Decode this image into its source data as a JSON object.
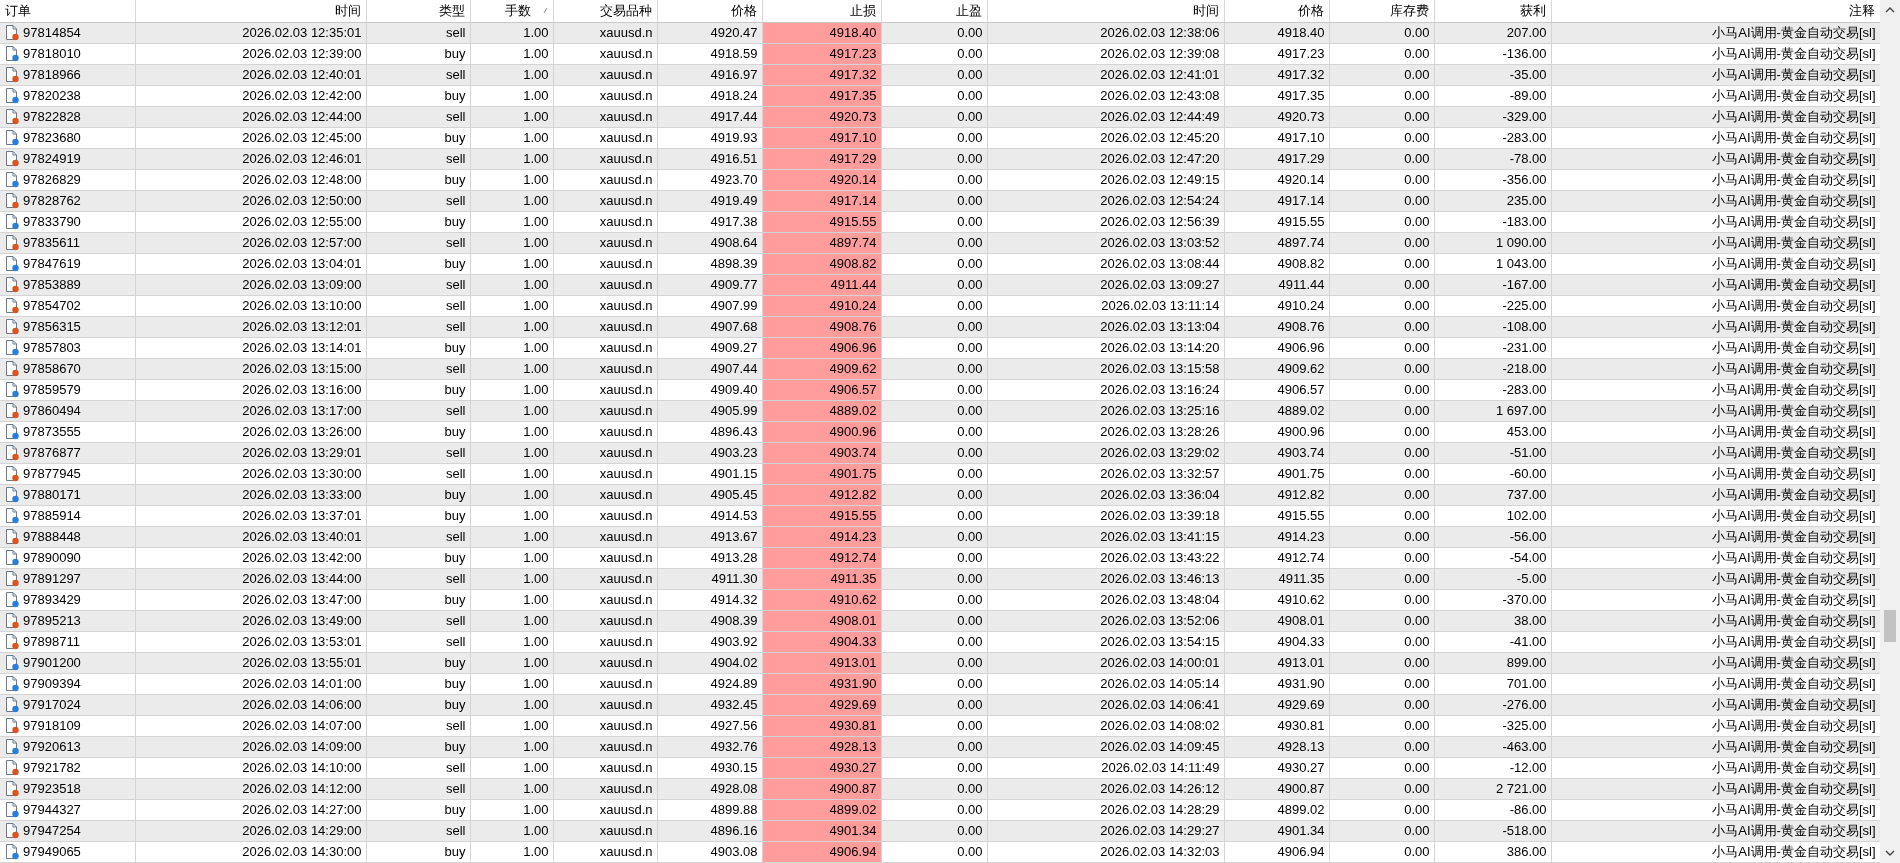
{
  "table": {
    "columns": [
      {
        "label": "订单",
        "sorted": false
      },
      {
        "label": "时间",
        "sorted": false
      },
      {
        "label": "类型",
        "sorted": false
      },
      {
        "label": "手数",
        "sorted": true
      },
      {
        "label": "交易品种",
        "sorted": false
      },
      {
        "label": "价格",
        "sorted": false
      },
      {
        "label": "止损",
        "sorted": false
      },
      {
        "label": "止盈",
        "sorted": false
      },
      {
        "label": "时间",
        "sorted": false
      },
      {
        "label": "价格",
        "sorted": false
      },
      {
        "label": "库存费",
        "sorted": false
      },
      {
        "label": "获利",
        "sorted": false
      },
      {
        "label": "注释",
        "sorted": false
      }
    ],
    "rows": [
      {
        "kind": "sell",
        "cells": [
          "97814854",
          "2026.02.03 12:35:01",
          "sell",
          "1.00",
          "xauusd.n",
          "4920.47",
          "4918.40",
          "0.00",
          "2026.02.03 12:38:06",
          "4918.40",
          "0.00",
          "207.00",
          "小马AI调用-黄金自动交易[sl]"
        ]
      },
      {
        "kind": "buy",
        "cells": [
          "97818010",
          "2026.02.03 12:39:00",
          "buy",
          "1.00",
          "xauusd.n",
          "4918.59",
          "4917.23",
          "0.00",
          "2026.02.03 12:39:08",
          "4917.23",
          "0.00",
          "-136.00",
          "小马AI调用-黄金自动交易[sl]"
        ]
      },
      {
        "kind": "sell",
        "cells": [
          "97818966",
          "2026.02.03 12:40:01",
          "sell",
          "1.00",
          "xauusd.n",
          "4916.97",
          "4917.32",
          "0.00",
          "2026.02.03 12:41:01",
          "4917.32",
          "0.00",
          "-35.00",
          "小马AI调用-黄金自动交易[sl]"
        ]
      },
      {
        "kind": "buy",
        "cells": [
          "97820238",
          "2026.02.03 12:42:00",
          "buy",
          "1.00",
          "xauusd.n",
          "4918.24",
          "4917.35",
          "0.00",
          "2026.02.03 12:43:08",
          "4917.35",
          "0.00",
          "-89.00",
          "小马AI调用-黄金自动交易[sl]"
        ]
      },
      {
        "kind": "sell",
        "cells": [
          "97822828",
          "2026.02.03 12:44:00",
          "sell",
          "1.00",
          "xauusd.n",
          "4917.44",
          "4920.73",
          "0.00",
          "2026.02.03 12:44:49",
          "4920.73",
          "0.00",
          "-329.00",
          "小马AI调用-黄金自动交易[sl]"
        ]
      },
      {
        "kind": "buy",
        "cells": [
          "97823680",
          "2026.02.03 12:45:00",
          "buy",
          "1.00",
          "xauusd.n",
          "4919.93",
          "4917.10",
          "0.00",
          "2026.02.03 12:45:20",
          "4917.10",
          "0.00",
          "-283.00",
          "小马AI调用-黄金自动交易[sl]"
        ]
      },
      {
        "kind": "sell",
        "cells": [
          "97824919",
          "2026.02.03 12:46:01",
          "sell",
          "1.00",
          "xauusd.n",
          "4916.51",
          "4917.29",
          "0.00",
          "2026.02.03 12:47:20",
          "4917.29",
          "0.00",
          "-78.00",
          "小马AI调用-黄金自动交易[sl]"
        ]
      },
      {
        "kind": "buy",
        "cells": [
          "97826829",
          "2026.02.03 12:48:00",
          "buy",
          "1.00",
          "xauusd.n",
          "4923.70",
          "4920.14",
          "0.00",
          "2026.02.03 12:49:15",
          "4920.14",
          "0.00",
          "-356.00",
          "小马AI调用-黄金自动交易[sl]"
        ]
      },
      {
        "kind": "sell",
        "cells": [
          "97828762",
          "2026.02.03 12:50:00",
          "sell",
          "1.00",
          "xauusd.n",
          "4919.49",
          "4917.14",
          "0.00",
          "2026.02.03 12:54:24",
          "4917.14",
          "0.00",
          "235.00",
          "小马AI调用-黄金自动交易[sl]"
        ]
      },
      {
        "kind": "buy",
        "cells": [
          "97833790",
          "2026.02.03 12:55:00",
          "buy",
          "1.00",
          "xauusd.n",
          "4917.38",
          "4915.55",
          "0.00",
          "2026.02.03 12:56:39",
          "4915.55",
          "0.00",
          "-183.00",
          "小马AI调用-黄金自动交易[sl]"
        ]
      },
      {
        "kind": "sell",
        "cells": [
          "97835611",
          "2026.02.03 12:57:00",
          "sell",
          "1.00",
          "xauusd.n",
          "4908.64",
          "4897.74",
          "0.00",
          "2026.02.03 13:03:52",
          "4897.74",
          "0.00",
          "1 090.00",
          "小马AI调用-黄金自动交易[sl]"
        ]
      },
      {
        "kind": "buy",
        "cells": [
          "97847619",
          "2026.02.03 13:04:01",
          "buy",
          "1.00",
          "xauusd.n",
          "4898.39",
          "4908.82",
          "0.00",
          "2026.02.03 13:08:44",
          "4908.82",
          "0.00",
          "1 043.00",
          "小马AI调用-黄金自动交易[sl]"
        ]
      },
      {
        "kind": "sell",
        "cells": [
          "97853889",
          "2026.02.03 13:09:00",
          "sell",
          "1.00",
          "xauusd.n",
          "4909.77",
          "4911.44",
          "0.00",
          "2026.02.03 13:09:27",
          "4911.44",
          "0.00",
          "-167.00",
          "小马AI调用-黄金自动交易[sl]"
        ]
      },
      {
        "kind": "sell",
        "cells": [
          "97854702",
          "2026.02.03 13:10:00",
          "sell",
          "1.00",
          "xauusd.n",
          "4907.99",
          "4910.24",
          "0.00",
          "2026.02.03 13:11:14",
          "4910.24",
          "0.00",
          "-225.00",
          "小马AI调用-黄金自动交易[sl]"
        ]
      },
      {
        "kind": "sell",
        "cells": [
          "97856315",
          "2026.02.03 13:12:01",
          "sell",
          "1.00",
          "xauusd.n",
          "4907.68",
          "4908.76",
          "0.00",
          "2026.02.03 13:13:04",
          "4908.76",
          "0.00",
          "-108.00",
          "小马AI调用-黄金自动交易[sl]"
        ]
      },
      {
        "kind": "buy",
        "cells": [
          "97857803",
          "2026.02.03 13:14:01",
          "buy",
          "1.00",
          "xauusd.n",
          "4909.27",
          "4906.96",
          "0.00",
          "2026.02.03 13:14:20",
          "4906.96",
          "0.00",
          "-231.00",
          "小马AI调用-黄金自动交易[sl]"
        ]
      },
      {
        "kind": "sell",
        "cells": [
          "97858670",
          "2026.02.03 13:15:00",
          "sell",
          "1.00",
          "xauusd.n",
          "4907.44",
          "4909.62",
          "0.00",
          "2026.02.03 13:15:58",
          "4909.62",
          "0.00",
          "-218.00",
          "小马AI调用-黄金自动交易[sl]"
        ]
      },
      {
        "kind": "buy",
        "cells": [
          "97859579",
          "2026.02.03 13:16:00",
          "buy",
          "1.00",
          "xauusd.n",
          "4909.40",
          "4906.57",
          "0.00",
          "2026.02.03 13:16:24",
          "4906.57",
          "0.00",
          "-283.00",
          "小马AI调用-黄金自动交易[sl]"
        ]
      },
      {
        "kind": "sell",
        "cells": [
          "97860494",
          "2026.02.03 13:17:00",
          "sell",
          "1.00",
          "xauusd.n",
          "4905.99",
          "4889.02",
          "0.00",
          "2026.02.03 13:25:16",
          "4889.02",
          "0.00",
          "1 697.00",
          "小马AI调用-黄金自动交易[sl]"
        ]
      },
      {
        "kind": "buy",
        "cells": [
          "97873555",
          "2026.02.03 13:26:00",
          "buy",
          "1.00",
          "xauusd.n",
          "4896.43",
          "4900.96",
          "0.00",
          "2026.02.03 13:28:26",
          "4900.96",
          "0.00",
          "453.00",
          "小马AI调用-黄金自动交易[sl]"
        ]
      },
      {
        "kind": "sell",
        "cells": [
          "97876877",
          "2026.02.03 13:29:01",
          "sell",
          "1.00",
          "xauusd.n",
          "4903.23",
          "4903.74",
          "0.00",
          "2026.02.03 13:29:02",
          "4903.74",
          "0.00",
          "-51.00",
          "小马AI调用-黄金自动交易[sl]"
        ]
      },
      {
        "kind": "sell",
        "cells": [
          "97877945",
          "2026.02.03 13:30:00",
          "sell",
          "1.00",
          "xauusd.n",
          "4901.15",
          "4901.75",
          "0.00",
          "2026.02.03 13:32:57",
          "4901.75",
          "0.00",
          "-60.00",
          "小马AI调用-黄金自动交易[sl]"
        ]
      },
      {
        "kind": "buy",
        "cells": [
          "97880171",
          "2026.02.03 13:33:00",
          "buy",
          "1.00",
          "xauusd.n",
          "4905.45",
          "4912.82",
          "0.00",
          "2026.02.03 13:36:04",
          "4912.82",
          "0.00",
          "737.00",
          "小马AI调用-黄金自动交易[sl]"
        ]
      },
      {
        "kind": "buy",
        "cells": [
          "97885914",
          "2026.02.03 13:37:01",
          "buy",
          "1.00",
          "xauusd.n",
          "4914.53",
          "4915.55",
          "0.00",
          "2026.02.03 13:39:18",
          "4915.55",
          "0.00",
          "102.00",
          "小马AI调用-黄金自动交易[sl]"
        ]
      },
      {
        "kind": "sell",
        "cells": [
          "97888448",
          "2026.02.03 13:40:01",
          "sell",
          "1.00",
          "xauusd.n",
          "4913.67",
          "4914.23",
          "0.00",
          "2026.02.03 13:41:15",
          "4914.23",
          "0.00",
          "-56.00",
          "小马AI调用-黄金自动交易[sl]"
        ]
      },
      {
        "kind": "buy",
        "cells": [
          "97890090",
          "2026.02.03 13:42:00",
          "buy",
          "1.00",
          "xauusd.n",
          "4913.28",
          "4912.74",
          "0.00",
          "2026.02.03 13:43:22",
          "4912.74",
          "0.00",
          "-54.00",
          "小马AI调用-黄金自动交易[sl]"
        ]
      },
      {
        "kind": "sell",
        "cells": [
          "97891297",
          "2026.02.03 13:44:00",
          "sell",
          "1.00",
          "xauusd.n",
          "4911.30",
          "4911.35",
          "0.00",
          "2026.02.03 13:46:13",
          "4911.35",
          "0.00",
          "-5.00",
          "小马AI调用-黄金自动交易[sl]"
        ]
      },
      {
        "kind": "buy",
        "cells": [
          "97893429",
          "2026.02.03 13:47:00",
          "buy",
          "1.00",
          "xauusd.n",
          "4914.32",
          "4910.62",
          "0.00",
          "2026.02.03 13:48:04",
          "4910.62",
          "0.00",
          "-370.00",
          "小马AI调用-黄金自动交易[sl]"
        ]
      },
      {
        "kind": "sell",
        "cells": [
          "97895213",
          "2026.02.03 13:49:00",
          "sell",
          "1.00",
          "xauusd.n",
          "4908.39",
          "4908.01",
          "0.00",
          "2026.02.03 13:52:06",
          "4908.01",
          "0.00",
          "38.00",
          "小马AI调用-黄金自动交易[sl]"
        ]
      },
      {
        "kind": "sell",
        "cells": [
          "97898711",
          "2026.02.03 13:53:01",
          "sell",
          "1.00",
          "xauusd.n",
          "4903.92",
          "4904.33",
          "0.00",
          "2026.02.03 13:54:15",
          "4904.33",
          "0.00",
          "-41.00",
          "小马AI调用-黄金自动交易[sl]"
        ]
      },
      {
        "kind": "buy",
        "cells": [
          "97901200",
          "2026.02.03 13:55:01",
          "buy",
          "1.00",
          "xauusd.n",
          "4904.02",
          "4913.01",
          "0.00",
          "2026.02.03 14:00:01",
          "4913.01",
          "0.00",
          "899.00",
          "小马AI调用-黄金自动交易[sl]"
        ]
      },
      {
        "kind": "buy",
        "cells": [
          "97909394",
          "2026.02.03 14:01:00",
          "buy",
          "1.00",
          "xauusd.n",
          "4924.89",
          "4931.90",
          "0.00",
          "2026.02.03 14:05:14",
          "4931.90",
          "0.00",
          "701.00",
          "小马AI调用-黄金自动交易[sl]"
        ]
      },
      {
        "kind": "buy",
        "cells": [
          "97917024",
          "2026.02.03 14:06:00",
          "buy",
          "1.00",
          "xauusd.n",
          "4932.45",
          "4929.69",
          "0.00",
          "2026.02.03 14:06:41",
          "4929.69",
          "0.00",
          "-276.00",
          "小马AI调用-黄金自动交易[sl]"
        ]
      },
      {
        "kind": "sell",
        "cells": [
          "97918109",
          "2026.02.03 14:07:00",
          "sell",
          "1.00",
          "xauusd.n",
          "4927.56",
          "4930.81",
          "0.00",
          "2026.02.03 14:08:02",
          "4930.81",
          "0.00",
          "-325.00",
          "小马AI调用-黄金自动交易[sl]"
        ]
      },
      {
        "kind": "buy",
        "cells": [
          "97920613",
          "2026.02.03 14:09:00",
          "buy",
          "1.00",
          "xauusd.n",
          "4932.76",
          "4928.13",
          "0.00",
          "2026.02.03 14:09:45",
          "4928.13",
          "0.00",
          "-463.00",
          "小马AI调用-黄金自动交易[sl]"
        ]
      },
      {
        "kind": "sell",
        "cells": [
          "97921782",
          "2026.02.03 14:10:00",
          "sell",
          "1.00",
          "xauusd.n",
          "4930.15",
          "4930.27",
          "0.00",
          "2026.02.03 14:11:49",
          "4930.27",
          "0.00",
          "-12.00",
          "小马AI调用-黄金自动交易[sl]"
        ]
      },
      {
        "kind": "sell",
        "cells": [
          "97923518",
          "2026.02.03 14:12:00",
          "sell",
          "1.00",
          "xauusd.n",
          "4928.08",
          "4900.87",
          "0.00",
          "2026.02.03 14:26:12",
          "4900.87",
          "0.00",
          "2 721.00",
          "小马AI调用-黄金自动交易[sl]"
        ]
      },
      {
        "kind": "buy",
        "cells": [
          "97944327",
          "2026.02.03 14:27:00",
          "buy",
          "1.00",
          "xauusd.n",
          "4899.88",
          "4899.02",
          "0.00",
          "2026.02.03 14:28:29",
          "4899.02",
          "0.00",
          "-86.00",
          "小马AI调用-黄金自动交易[sl]"
        ]
      },
      {
        "kind": "sell",
        "cells": [
          "97947254",
          "2026.02.03 14:29:00",
          "sell",
          "1.00",
          "xauusd.n",
          "4896.16",
          "4901.34",
          "0.00",
          "2026.02.03 14:29:27",
          "4901.34",
          "0.00",
          "-518.00",
          "小马AI调用-黄金自动交易[sl]"
        ]
      },
      {
        "kind": "buy",
        "cells": [
          "97949065",
          "2026.02.03 14:30:00",
          "buy",
          "1.00",
          "xauusd.n",
          "4903.08",
          "4906.94",
          "0.00",
          "2026.02.03 14:32:03",
          "4906.94",
          "0.00",
          "386.00",
          "小马AI调用-黄金自动交易[sl]"
        ]
      }
    ]
  }
}
